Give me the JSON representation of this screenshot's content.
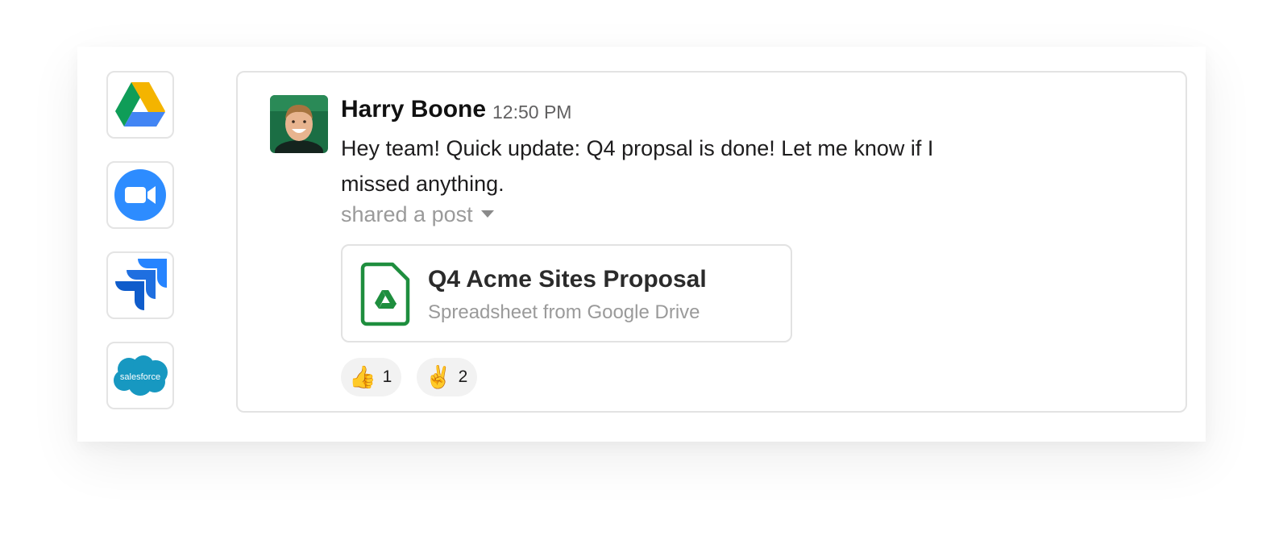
{
  "apps": [
    {
      "name": "Google Drive",
      "icon": "google-drive-icon"
    },
    {
      "name": "Zoom",
      "icon": "zoom-icon"
    },
    {
      "name": "Jira",
      "icon": "jira-icon"
    },
    {
      "name": "Salesforce",
      "icon": "salesforce-icon",
      "logo_text": "salesforce"
    }
  ],
  "message": {
    "author": "Harry Boone",
    "timestamp": "12:50 PM",
    "text": "Hey team! Quick update: Q4 propsal is done! Let me know if I missed anything.",
    "shared_label": "shared a post",
    "attachment": {
      "title": "Q4 Acme Sites Proposal",
      "subtitle": "Spreadsheet from Google Drive",
      "icon": "google-drive-file-icon"
    },
    "reactions": [
      {
        "emoji": "👍",
        "count": "1",
        "icon": "thumbs-up-icon"
      },
      {
        "emoji": "✌️",
        "count": "2",
        "icon": "victory-hand-icon"
      }
    ]
  },
  "colors": {
    "drive_green": "#0F9D58",
    "drive_yellow": "#F4B400",
    "drive_blue": "#4285F4",
    "zoom_blue": "#2D8CFF",
    "jira_blue": "#2684FF",
    "salesforce_blue": "#1798C1",
    "file_icon_green": "#1E8E3E"
  }
}
